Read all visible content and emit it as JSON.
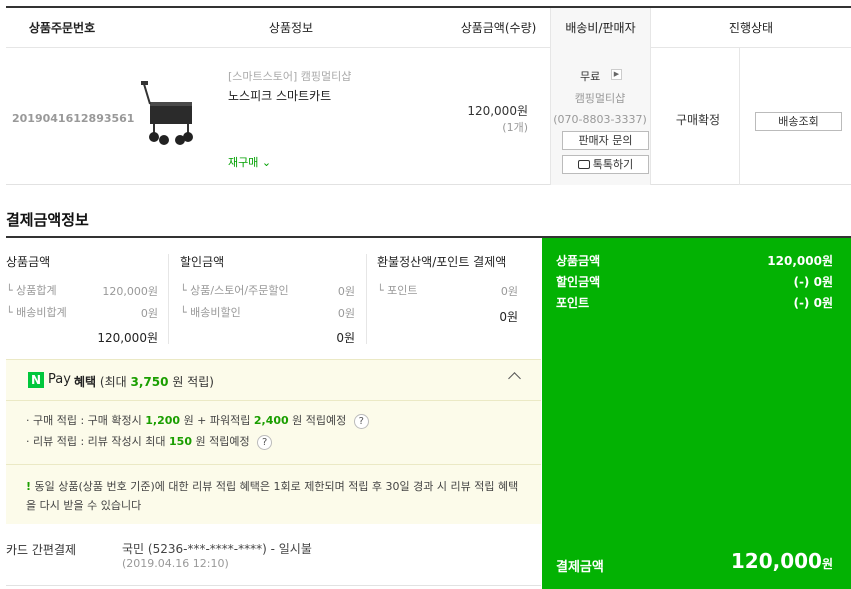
{
  "order_table": {
    "headers": {
      "order_no": "상품주문번호",
      "product_info": "상품정보",
      "price_qty": "상품금액(수량)",
      "shipping_seller": "배송비/판매자",
      "status": "진행상태"
    },
    "row": {
      "order_no": "2019041612893561",
      "shop": "[스마트스토어] 캠핑멀티샵",
      "product_name": "노스피크 스마트카트",
      "rebuy": "재구매",
      "price": "120,000원",
      "qty": "(1개)",
      "shipping": "무료",
      "seller": "캠핑멀티샵",
      "seller_tel": "(070-8803-3337)",
      "inquiry_button": "판매자 문의",
      "talk_button": "톡톡하기",
      "status": "구매확정",
      "track_button": "배송조회"
    }
  },
  "payment": {
    "title": "결제금액정보",
    "product_amount": {
      "title": "상품금액",
      "items": [
        {
          "label": "상품합계",
          "value": "120,000원"
        },
        {
          "label": "배송비합계",
          "value": "0원"
        }
      ],
      "total": "120,000원"
    },
    "discount": {
      "title": "할인금액",
      "items": [
        {
          "label": "상품/스토어/주문할인",
          "value": "0원"
        },
        {
          "label": "배송비할인",
          "value": "0원"
        }
      ],
      "total": "0원"
    },
    "refund": {
      "title": "환불정산액/포인트 결제액",
      "items": [
        {
          "label": "포인트",
          "value": "0원"
        }
      ],
      "total": "0원"
    }
  },
  "npay": {
    "logo": "N",
    "pay": "Pay",
    "benefit_label": "혜택",
    "benefit_prefix": "(최대",
    "benefit_max": "3,750",
    "benefit_suffix": "원 적립)",
    "purchase": {
      "prefix": "· 구매 적립 : 구매 확정시",
      "amount1": "1,200",
      "middle": "원 + 파워적립",
      "amount2": "2,400",
      "suffix": "원 적립예정"
    },
    "review": {
      "prefix": "· 리뷰 적립 : 리뷰 작성시 최대",
      "amount": "150",
      "suffix": "원 적립예정"
    },
    "notice_mark": "!",
    "notice": "동일 상품(상품 번호 기준)에 대한 리뷰 적립 혜택은 1회로 제한되며 적립 후 30일 경과 시 리뷰 적립 혜택을 다시 받을 수 있습니다"
  },
  "card": {
    "label": "카드 간편결제",
    "value": "국민 (5236-***-****-****) - 일시불",
    "date": "(2019.04.16 12:10)"
  },
  "summary": {
    "rows": [
      {
        "label": "상품금액",
        "value": "120,000원"
      },
      {
        "label": "할인금액",
        "value": "(-) 0원"
      },
      {
        "label": "포인트",
        "value": "(-) 0원"
      }
    ],
    "final_label": "결제금액",
    "final_value": "120,000",
    "final_unit": "원"
  },
  "colors": {
    "accent_green": "#03b203",
    "benefit_green": "#1a9e00",
    "npay_bg": "#fcfbea"
  }
}
